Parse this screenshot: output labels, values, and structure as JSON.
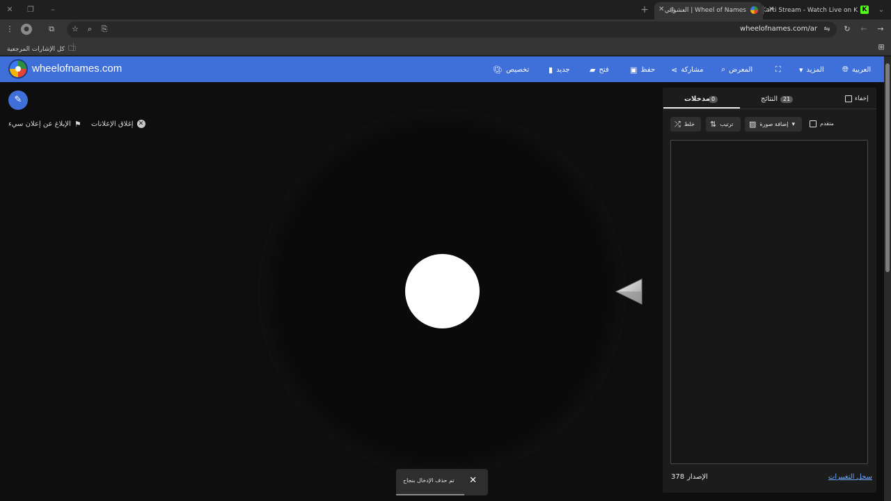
{
  "browser": {
    "tabs": [
      {
        "title": "Wheel of Names | العشوائي",
        "active": true
      },
      {
        "title": "1Karti Stream - Watch Live on K",
        "active": false
      }
    ],
    "url": "wheelofnames.com/ar",
    "bookmarks_label": "كل الإشارات المرجعية",
    "new_tab_symbol": "+"
  },
  "site": {
    "title": "wheelofnames.com",
    "nav": {
      "language": "العربية",
      "more": "المزيد",
      "gallery": "المعرض",
      "share": "مشاركة",
      "save": "حفظ",
      "open": "فتح",
      "new": "جديد",
      "customize": "تخصيص"
    },
    "brand_color": "#3f6fd9"
  },
  "ads": {
    "close_ads": "إغلاق الإعلانات",
    "report_ad": "الإبلاغ عن إعلان سيء"
  },
  "panel": {
    "hide_label": "إخفاء",
    "tabs": [
      {
        "label": "مدخلات",
        "count": "0",
        "active": true
      },
      {
        "label": "النتائج",
        "count": "21",
        "active": false
      }
    ],
    "tools": {
      "shuffle": "خلط",
      "sort": "ترتيب",
      "add_image": "إضافة صورة",
      "advanced": "متقدم"
    },
    "entries_text": "",
    "changelog": "سجل التغييرات",
    "version_label": "الإصدار",
    "version_number": "378"
  },
  "toast": {
    "message": "تم حذف الإدخال بنجاح",
    "close": "✕"
  }
}
